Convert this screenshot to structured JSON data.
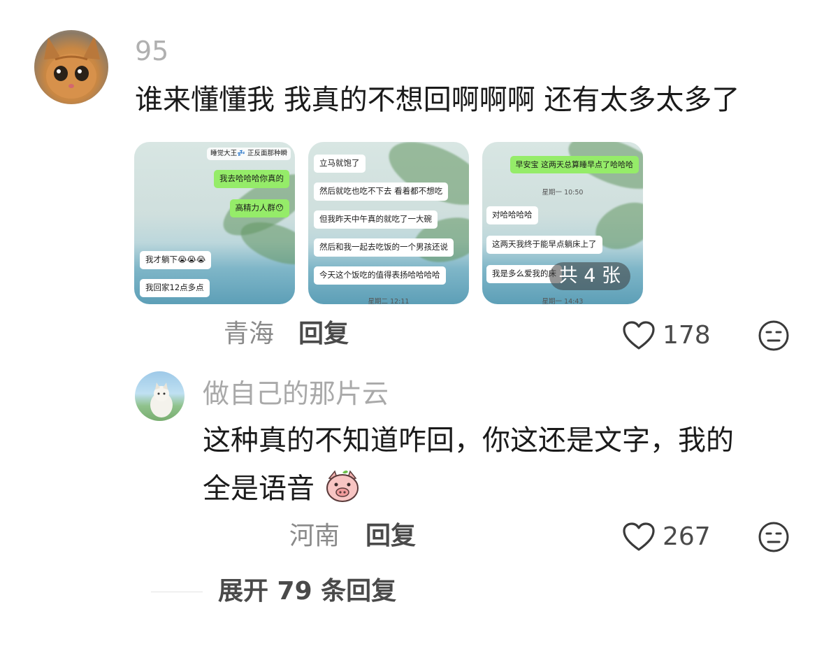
{
  "comment": {
    "username": "95",
    "text": "谁来懂懂我 我真的不想回啊啊啊 还有太多太多了",
    "location": "青海",
    "reply_label": "回复",
    "like_count": "178",
    "images": [
      {
        "messages": [
          {
            "text": "睡觉大王💤  正反面那种瞬",
            "side": "header"
          },
          {
            "text": "我去哈哈哈你真的",
            "side": "right"
          },
          {
            "text": "高精力人群😯",
            "side": "right"
          },
          {
            "text": "我才躺下😭😭😭",
            "side": "left"
          },
          {
            "text": "我回家12点多点",
            "side": "left"
          }
        ]
      },
      {
        "messages": [
          {
            "text": "立马就饱了",
            "side": "left"
          },
          {
            "text": "然后就吃也吃不下去 看着都不想吃",
            "side": "left"
          },
          {
            "text": "但我昨天中午真的就吃了一大碗",
            "side": "left"
          },
          {
            "text": "然后和我一起去吃饭的一个男孩还说",
            "side": "left"
          },
          {
            "text": "今天这个饭吃的值得表扬哈哈哈哈",
            "side": "left"
          }
        ],
        "timestamp": "星期二 12:11"
      },
      {
        "messages": [
          {
            "text": "早安宝 这两天总算睡早点了哈哈哈",
            "side": "right"
          },
          {
            "text": "对哈哈哈哈",
            "side": "left"
          },
          {
            "text": "这两天我终于能早点躺床上了",
            "side": "left"
          },
          {
            "text": "我是多么爱我的床",
            "side": "left"
          }
        ],
        "timestamps": [
          "星期一 10:50",
          "星期一 14:43"
        ],
        "more_badge": "共 4 张"
      }
    ]
  },
  "reply": {
    "username": "做自己的那片云",
    "text_line1": "这种真的不知道咋回，你这还是文字，我的",
    "text_line2": "全是语音",
    "emoji": "pig-face-emoji",
    "location": "河南",
    "reply_label": "回复",
    "like_count": "267"
  },
  "expand_replies": "展开 79 条回复",
  "icons": {
    "like": "heart-outline-icon",
    "dislike": "meh-face-icon"
  }
}
